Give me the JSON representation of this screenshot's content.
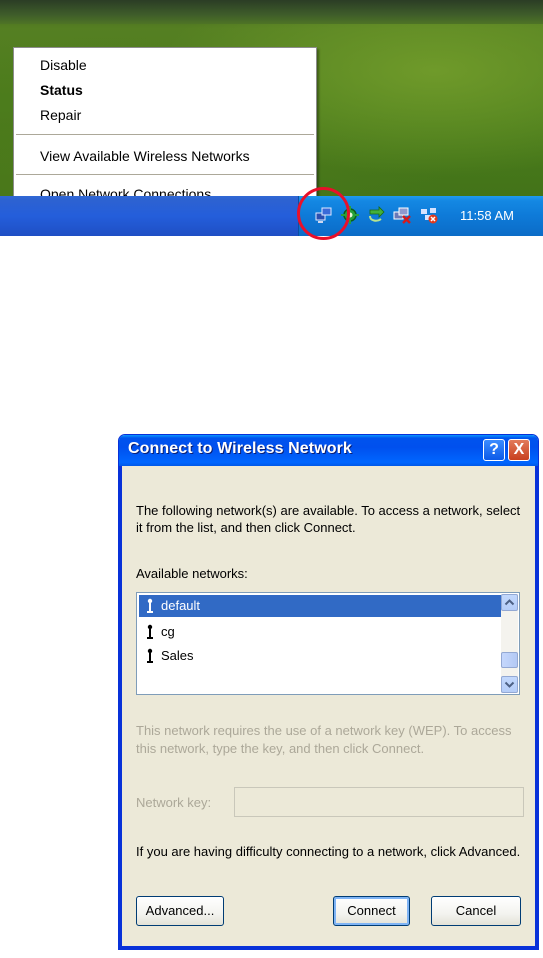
{
  "context_menu": {
    "items": [
      {
        "label": "Disable"
      },
      {
        "label": "Status"
      },
      {
        "label": "Repair"
      },
      {
        "label": "View Available Wireless Networks"
      },
      {
        "label": "Open Network Connections"
      }
    ]
  },
  "taskbar": {
    "clock": "11:58 AM",
    "tray_icons": [
      "network-connection-icon",
      "green-gear-icon",
      "green-arrow-icon",
      "network-disconnected-icon",
      "wireless-warning-icon"
    ],
    "highlight_color": "#e8102a"
  },
  "dialog": {
    "title": "Connect to Wireless Network",
    "help_button": "?",
    "close_button": "X",
    "intro_line1": "The following network(s) are available. To access a network, select",
    "intro_line2": "it from the list, and then click Connect.",
    "available_label": "Available networks:",
    "networks": [
      {
        "name": "default",
        "selected": true
      },
      {
        "name": "cg",
        "selected": false
      },
      {
        "name": "Sales",
        "selected": false
      }
    ],
    "key_info_line1": "This network requires the use of a network key (WEP). To access",
    "key_info_line2": "this network, type the key, and then click Connect.",
    "network_key_label": "Network key:",
    "network_key_value": "",
    "advanced_info": "If you are having difficulty connecting to a network, click Advanced.",
    "advanced_button": "Advanced...",
    "connect_button": "Connect",
    "cancel_button": "Cancel",
    "accent_color": "#0054e3",
    "selection_color": "#316ac5"
  }
}
